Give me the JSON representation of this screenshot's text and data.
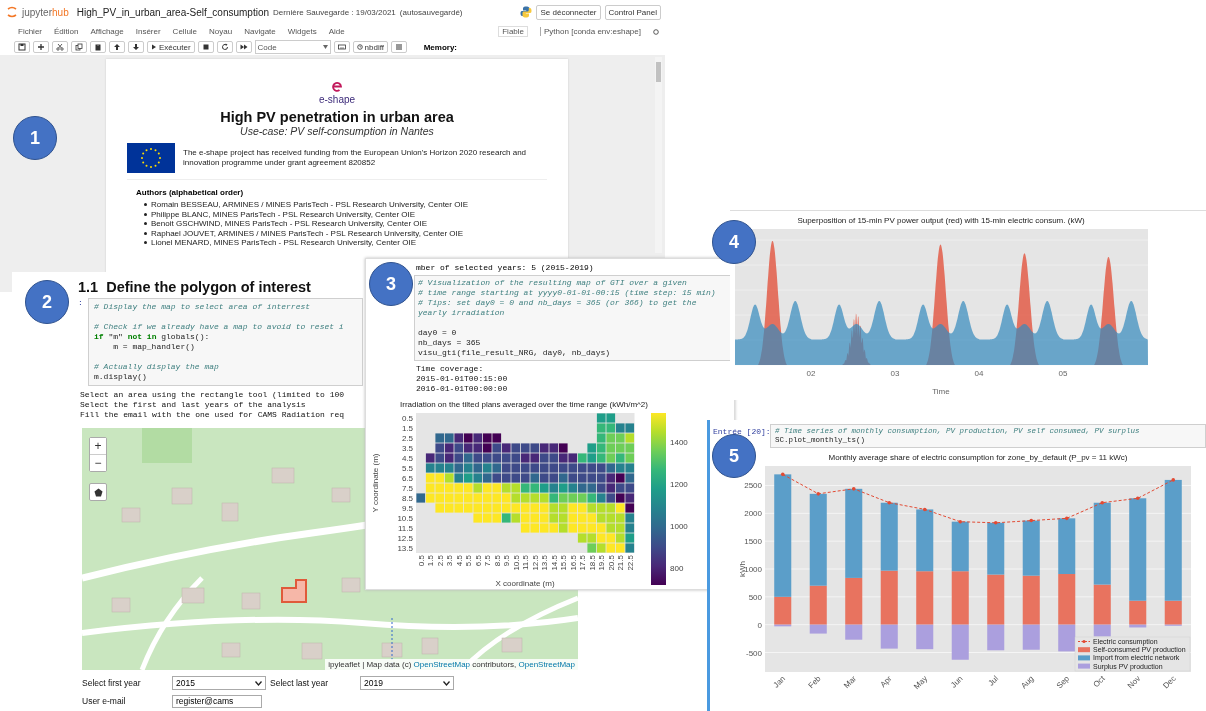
{
  "notebook": {
    "badge": "1",
    "logo_main": "jupyter",
    "logo_accent": "hub",
    "title": "High_PV_in_urban_area-Self_consumption",
    "save_status": "Dernière Sauvegarde : 19/03/2021",
    "autosave": "(autosauvegardé)",
    "header_buttons": [
      "Se déconnecter",
      "Control Panel"
    ],
    "menu": [
      "Fichier",
      "Édition",
      "Affichage",
      "Insérer",
      "Cellule",
      "Noyau",
      "Navigate",
      "Widgets",
      "Aide"
    ],
    "trusted": "Fiable",
    "kernel": "Python [conda env:eshape]",
    "run_label": "Exécuter",
    "cell_type": "Code",
    "nbdiff": "nbdiff",
    "memory": "Memory:",
    "page": {
      "brand": "e-shape",
      "title": "High PV penetration in urban area",
      "subtitle": "Use-case: PV self-consumption in Nantes",
      "funding": "The e-shape project has received funding from the European Union's Horizon 2020 research and innovation programme under grant agreement 820852",
      "authors_heading": "Authors (alphabetical order)",
      "authors": [
        "Romain BESSEAU, ARMINES / MINES ParisTech - PSL Research University, Center OIE",
        "Philippe BLANC, MINES ParisTech - PSL Research University, Center OIE",
        "Benoit GSCHWIND, MINES ParisTech - PSL Research University, Center OIE",
        "Raphael JOUVET, ARMINES / MINES ParisTech - PSL Research University, Center OIE",
        "Lionel MENARD, MINES ParisTech - PSL Research University, Center OIE"
      ]
    }
  },
  "polygon": {
    "badge": "2",
    "heading": "1.1  Define the polygon of interest",
    "prompt": ":",
    "code": [
      {
        "kind": "comment",
        "text": "# Display the map to select area of interrest"
      },
      {
        "kind": "blank"
      },
      {
        "kind": "comment",
        "text": "# Check if we already have a map to avoid to reset i"
      },
      {
        "kind": "code",
        "text": "**if** \"m\" **not in** globals():"
      },
      {
        "kind": "code",
        "text": "    m = map_handler()"
      },
      {
        "kind": "blank"
      },
      {
        "kind": "comment",
        "text": "# Actually display the map"
      },
      {
        "kind": "code",
        "text": "m.display()"
      }
    ],
    "output": [
      "Select an area using the rectangle tool (limited to 100",
      "Select the first and last years of the analysis",
      "Fill the email with the one used for CAMS Radiation req"
    ],
    "map": {
      "zoom_in": "+",
      "zoom_out": "−",
      "attribution": [
        {
          "text": "ipyleaflet | Map data (c) ",
          "link": false
        },
        {
          "text": "OpenStreetMap",
          "link": true
        },
        {
          "text": " contributors, ",
          "link": false
        },
        {
          "text": "OpenStreetMap",
          "link": true
        }
      ]
    },
    "form": {
      "first_year": {
        "label": "Select first year",
        "value": "2015"
      },
      "last_year": {
        "label": "Select last year",
        "value": "2019"
      },
      "email": {
        "label": "User e-mail",
        "value": "register@cams"
      }
    }
  },
  "gti": {
    "badge": "3",
    "status": "mber of selected years: 5 (2015-2019)",
    "code": [
      {
        "kind": "comment",
        "text": "# Visualization of the resulting map of GTI over a given"
      },
      {
        "kind": "comment",
        "text": "# time range starting at yyyy0-01-01-00:15 (time step: 15 min)"
      },
      {
        "kind": "comment",
        "text": "# Tips: set day0 = 0 and nb_days = 365 (or 366) to get the yearly irradiation"
      },
      {
        "kind": "blank"
      },
      {
        "kind": "code",
        "text": "day0 = 0"
      },
      {
        "kind": "code",
        "text": "nb_days = 365"
      },
      {
        "kind": "code",
        "text": "visu_gti(file_result_NRG, day0, nb_days)"
      }
    ],
    "output": [
      "Time coverage:",
      "2015-01-01T00:15:00",
      "2016-01-01T00:00:00"
    ],
    "heatmap": {
      "title": "Irradiation on the tilted plans averaged over the time range (kWh/m^2)",
      "xlabel": "X coordinate (m)",
      "ylabel": "Y coordinate (m)",
      "y_tick_labels": [
        "0.5",
        "1.5",
        "2.5",
        "3.5",
        "4.5",
        "5.5",
        "6.5",
        "7.5",
        "8.5",
        "9.5",
        "10.5",
        "11.5",
        "12.5",
        "13.5"
      ],
      "x_tick_labels": [
        "0.5",
        "1.5",
        "2.5",
        "3.5",
        "4.5",
        "5.5",
        "6.5",
        "7.5",
        "8.5",
        "9.5",
        "10.5",
        "11.5",
        "12.5",
        "13.5",
        "14.5",
        "15.5",
        "16.5",
        "17.5",
        "18.5",
        "19.5",
        "20.5",
        "21.5",
        "22.5"
      ],
      "colorbar_tick_labels": [
        "1400",
        "1200",
        "1000",
        "800"
      ]
    }
  },
  "power": {
    "badge": "4",
    "title": "Superposition of 15-min PV power output (red) with 15-min electric consum. (kW)",
    "x_tick_labels": [
      "02",
      "03",
      "04",
      "05"
    ],
    "xlabel": "Time"
  },
  "monthly": {
    "badge": "5",
    "prompt": "Entrée [20]:",
    "code": [
      {
        "kind": "comment",
        "text": "# Time series of monthly consumption, PV production, PV self consumed, PV surplus"
      },
      {
        "kind": "code",
        "text": "SC.plot_monthly_ts()"
      }
    ],
    "chart_data": {
      "type": "bar",
      "title": "Monthly average share of electric consumption for zone_by_default (P_pv = 11 kWc)",
      "ylabel": "kWh",
      "stacked": true,
      "categories": [
        "Jan",
        "Feb",
        "Mar",
        "Apr",
        "May",
        "Jun",
        "Jul",
        "Aug",
        "Sep",
        "Oct",
        "Nov",
        "Dec"
      ],
      "ylim": [
        -850,
        2850
      ],
      "grid": true,
      "legend": "lower right",
      "yticks": [
        -500,
        0,
        500,
        1000,
        1500,
        2000,
        2500
      ],
      "series": [
        {
          "name": "Electric consumption",
          "type": "line",
          "line_style": "dashed",
          "color": "#e24a33",
          "values": [
            2700,
            2350,
            2440,
            2190,
            2070,
            1850,
            1830,
            1870,
            1910,
            2190,
            2270,
            2600
          ]
        },
        {
          "name": "Self-consumed PV production",
          "type": "bar",
          "color": "#e8735f",
          "values": [
            500,
            700,
            840,
            970,
            960,
            960,
            900,
            880,
            910,
            720,
            430,
            430
          ]
        },
        {
          "name": "Import from electric network",
          "type": "bar",
          "color": "#5b9ec9",
          "values": [
            2200,
            1650,
            1600,
            1220,
            1110,
            890,
            930,
            990,
            1000,
            1470,
            1840,
            2170
          ]
        },
        {
          "name": "Surplus PV production",
          "type": "bar",
          "color": "#ab9fde",
          "values": [
            -30,
            -160,
            -270,
            -430,
            -440,
            -630,
            -460,
            -450,
            -480,
            -210,
            -50,
            -20
          ]
        }
      ]
    }
  }
}
